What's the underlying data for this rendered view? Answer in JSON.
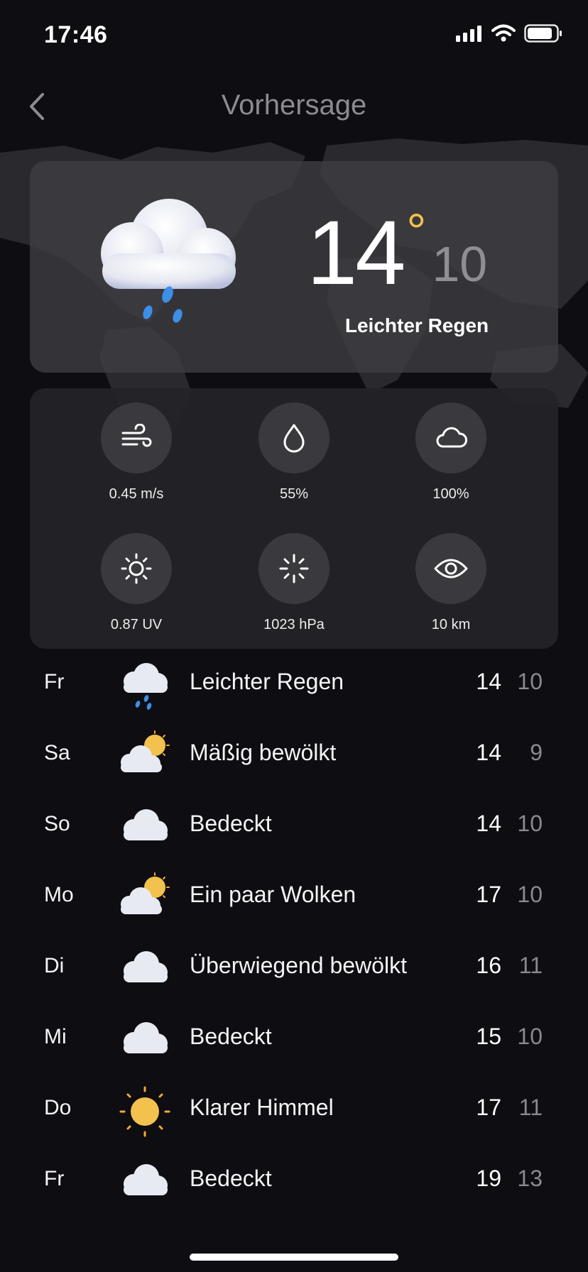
{
  "status_bar": {
    "time": "17:46"
  },
  "nav": {
    "title": "Vorhersage"
  },
  "current": {
    "temp_high": "14",
    "degree_symbol": "°",
    "temp_low": "10",
    "condition": "Leichter Regen",
    "icon": "cloud-rain-icon"
  },
  "metrics": [
    {
      "icon": "wind-icon",
      "value": "0.45 m/s"
    },
    {
      "icon": "humidity-drop-icon",
      "value": "55%"
    },
    {
      "icon": "cloud-cover-icon",
      "value": "100%"
    },
    {
      "icon": "uv-sun-icon",
      "value": "0.87 UV"
    },
    {
      "icon": "pressure-icon",
      "value": "1023 hPa"
    },
    {
      "icon": "visibility-eye-icon",
      "value": "10 km"
    }
  ],
  "forecast": [
    {
      "day": "Fr",
      "icon": "cloud-rain-icon",
      "condition": "Leichter Regen",
      "high": "14",
      "low": "10"
    },
    {
      "day": "Sa",
      "icon": "sun-cloud-icon",
      "condition": "Mäßig bewölkt",
      "high": "14",
      "low": "9"
    },
    {
      "day": "So",
      "icon": "cloud-icon",
      "condition": "Bedeckt",
      "high": "14",
      "low": "10"
    },
    {
      "day": "Mo",
      "icon": "sun-cloud-icon",
      "condition": "Ein paar Wolken",
      "high": "17",
      "low": "10"
    },
    {
      "day": "Di",
      "icon": "cloud-icon",
      "condition": "Überwiegend bewölkt",
      "high": "16",
      "low": "11"
    },
    {
      "day": "Mi",
      "icon": "cloud-icon",
      "condition": "Bedeckt",
      "high": "15",
      "low": "10"
    },
    {
      "day": "Do",
      "icon": "sun-icon",
      "condition": "Klarer Himmel",
      "high": "17",
      "low": "11"
    },
    {
      "day": "Fr",
      "icon": "cloud-icon",
      "condition": "Bedeckt",
      "high": "19",
      "low": "13"
    }
  ],
  "colors": {
    "background": "#0e0d12",
    "card": "#3e3e42",
    "accent_degree": "#f2c14e",
    "muted_text": "#8a8a8e"
  }
}
